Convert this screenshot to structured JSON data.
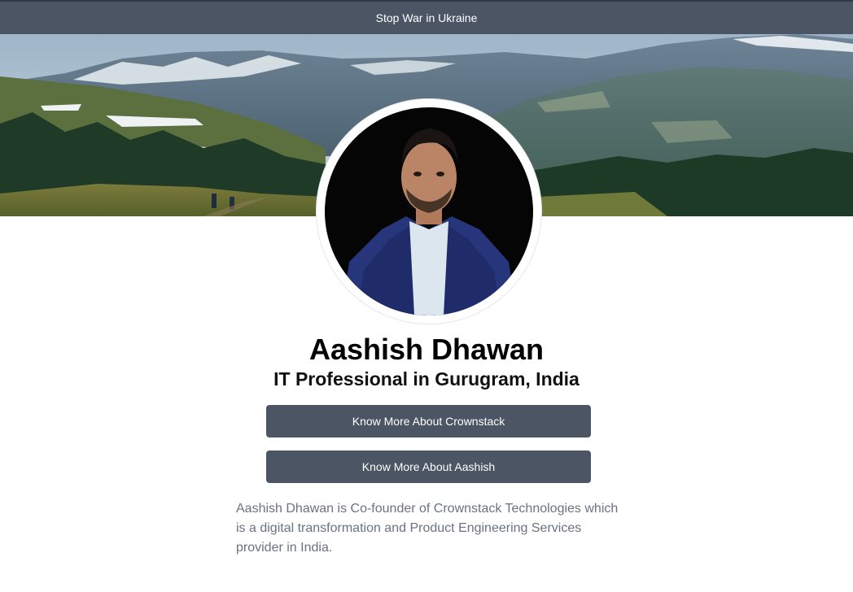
{
  "banner": {
    "text": "Stop War in Ukraine"
  },
  "profile": {
    "name": "Aashish Dhawan",
    "headline": "IT Professional in Gurugram, India",
    "bio": "Aashish Dhawan is Co-founder of Crownstack Technologies which is a digital transformation and Product Engineering Services provider in India."
  },
  "buttons": {
    "crownstack": "Know More About Crownstack",
    "aashish": "Know More About Aashish"
  },
  "colors": {
    "banner_bg": "#4b5563",
    "button_bg": "#4b5563",
    "bio_text": "#6b7280"
  }
}
